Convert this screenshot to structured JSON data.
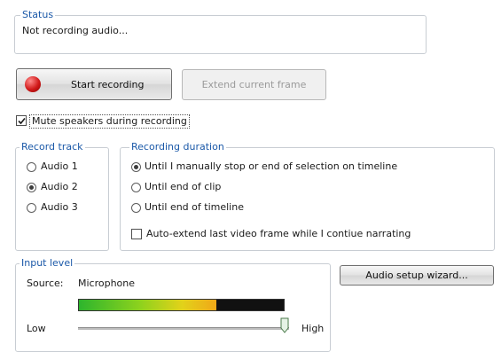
{
  "status": {
    "legend": "Status",
    "text": "Not recording audio..."
  },
  "buttons": {
    "start_recording": "Start recording",
    "extend_frame": "Extend current frame",
    "audio_setup": "Audio setup wizard..."
  },
  "mute_speakers": {
    "label": "Mute speakers during recording",
    "checked": true
  },
  "record_track": {
    "legend": "Record track",
    "options": [
      "Audio 1",
      "Audio 2",
      "Audio 3"
    ],
    "selected": "Audio 2"
  },
  "recording_duration": {
    "legend": "Recording duration",
    "options": [
      "Until I manually stop or end of selection on timeline",
      "Until end of clip",
      "Until end of timeline"
    ],
    "selected": "Until I manually stop or end of selection on timeline",
    "auto_extend_label": "Auto-extend last video frame while I contiue narrating",
    "auto_extend_checked": false
  },
  "input_level": {
    "legend": "Input level",
    "source_label": "Source:",
    "source_value": "Microphone",
    "low_label": "Low",
    "high_label": "High",
    "level_fraction": 0.67,
    "slider_fraction": 0.98
  },
  "colors": {
    "record_red": "#d11a1a",
    "legend_blue": "#1a58a8"
  }
}
